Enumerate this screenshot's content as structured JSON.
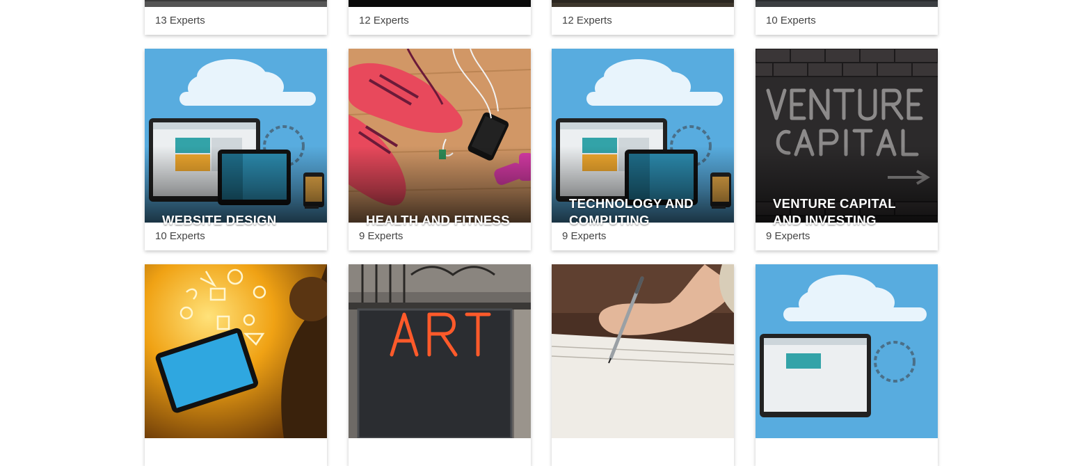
{
  "cards_top": [
    {
      "count": "13 Experts"
    },
    {
      "count": "12 Experts"
    },
    {
      "count": "12 Experts"
    },
    {
      "count": "10 Experts"
    }
  ],
  "cards_middle": [
    {
      "title": "WEBSITE DESIGN",
      "count": "10 Experts",
      "image": "cloud-devices-illustration"
    },
    {
      "title": "HEALTH AND FITNESS",
      "count": "9 Experts",
      "image": "sneakers-and-phone-photo"
    },
    {
      "title": "TECHNOLOGY AND COMPUTING",
      "count": "9 Experts",
      "image": "cloud-devices-illustration"
    },
    {
      "title": "VENTURE CAPITAL AND INVESTING",
      "count": "9 Experts",
      "image": "venture-capital-brick-wall-photo",
      "image_text": "VENTURE CAPITAL"
    }
  ],
  "cards_bottom": [
    {
      "image": "tablet-app-icons-photo"
    },
    {
      "image": "art-neon-sign-photo",
      "image_text": "ART"
    },
    {
      "image": "hand-writing-photo"
    },
    {
      "image": "cloud-devices-illustration"
    }
  ],
  "colors": {
    "sky_blue": "#58acdf",
    "count_text": "#444444",
    "title_text": "#ffffff"
  }
}
